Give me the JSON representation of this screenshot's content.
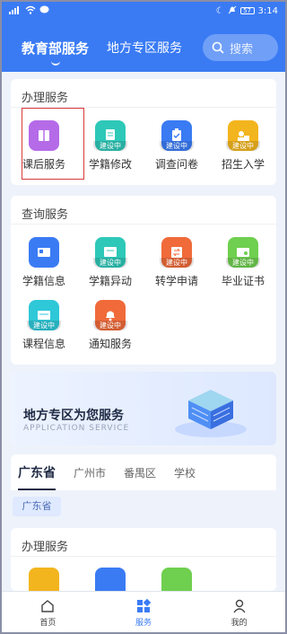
{
  "status": {
    "time": "3:14",
    "battery": "57"
  },
  "header": {
    "tabs": [
      {
        "label": "教育部服务"
      },
      {
        "label": "地方专区服务"
      }
    ],
    "search_label": "搜索"
  },
  "sections": {
    "handle": {
      "title": "办理服务",
      "items": [
        {
          "label": "课后服务",
          "color": "#b56be8",
          "building": ""
        },
        {
          "label": "学籍修改",
          "color": "#2ec8b8",
          "building": "建设中"
        },
        {
          "label": "调查问卷",
          "color": "#3a7bf4",
          "building": "建设中"
        },
        {
          "label": "招生入学",
          "color": "#f3b51e",
          "building": "建设中"
        }
      ]
    },
    "query": {
      "title": "查询服务",
      "items": [
        {
          "label": "学籍信息",
          "color": "#3a7bf4",
          "building": ""
        },
        {
          "label": "学籍异动",
          "color": "#2ec8b8",
          "building": "建设中"
        },
        {
          "label": "转学申请",
          "color": "#f06a3a",
          "building": "建设中"
        },
        {
          "label": "毕业证书",
          "color": "#6fcf4f",
          "building": "建设中"
        },
        {
          "label": "课程信息",
          "color": "#2ec8d8",
          "building": "建设中"
        },
        {
          "label": "通知服务",
          "color": "#f06a3a",
          "building": "建设中"
        }
      ]
    }
  },
  "banner": {
    "title": "地方专区为您服务",
    "subtitle": "APPLICATION SERVICE"
  },
  "region_tabs": [
    {
      "label": "广东省"
    },
    {
      "label": "广州市"
    },
    {
      "label": "番禺区"
    },
    {
      "label": "学校"
    }
  ],
  "chip": "广东省",
  "local": {
    "title": "办理服务",
    "icons": [
      {
        "color": "#f3b51e"
      },
      {
        "color": "#3a7bf4"
      },
      {
        "color": "#6fcf4f"
      }
    ]
  },
  "bottom_nav": [
    {
      "label": "首页"
    },
    {
      "label": "服务"
    },
    {
      "label": "我的"
    }
  ]
}
